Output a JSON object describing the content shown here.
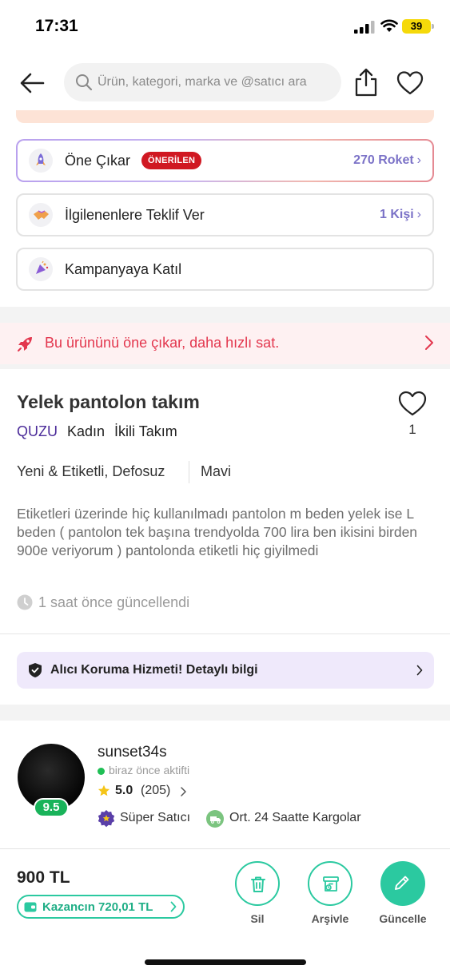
{
  "status_bar": {
    "time": "17:31",
    "battery": "39"
  },
  "search": {
    "placeholder": "Ürün, kategori, marka ve @satıcı ara"
  },
  "boost_options": [
    {
      "label": "Öne Çıkar",
      "badge": "ÖNERİLEN",
      "right": "270 Roket"
    },
    {
      "label": "İlgilenenlere Teklif Ver",
      "right": "1 Kişi"
    },
    {
      "label": "Kampanyaya Katıl"
    }
  ],
  "promo_banner": {
    "text": "Bu ürününü öne çıkar, daha hızlı sat."
  },
  "product": {
    "title": "Yelek pantolon takım",
    "brand": "QUZU",
    "gender": "Kadın",
    "category": "İkili Takım",
    "condition": "Yeni & Etiketli, Defosuz",
    "color": "Mavi",
    "description": "Etiketleri üzerinde hiç kullanılmadı pantolon m beden yelek ise L beden ( pantolon tek başına trendyolda 700 lira ben ikisini birden 900e veriyorum ) pantolonda etiketli hiç giyilmedi",
    "updated": "1 saat önce güncellendi",
    "like_count": "1"
  },
  "buyer_protection": {
    "text": "Alıcı Koruma Hizmeti! Detaylı bilgi"
  },
  "seller": {
    "username": "sunset34s",
    "status": "biraz önce aktifti",
    "rating": "5.0",
    "review_count": "(205)",
    "score": "9.5",
    "badges": [
      "Süper Satıcı",
      "Ort. 24 Saatte Kargolar"
    ]
  },
  "bottom_bar": {
    "price": "900 TL",
    "earnings": "Kazancın 720,01 TL",
    "actions": [
      {
        "label": "Sil",
        "icon": "trash-icon"
      },
      {
        "label": "Arşivle",
        "icon": "archive-icon"
      },
      {
        "label": "Güncelle",
        "icon": "pencil-icon"
      }
    ]
  },
  "colors": {
    "accent": "#2bc9a0",
    "brand": "#4b2b99",
    "promo": "#e3374e",
    "badge": "#d01822"
  }
}
